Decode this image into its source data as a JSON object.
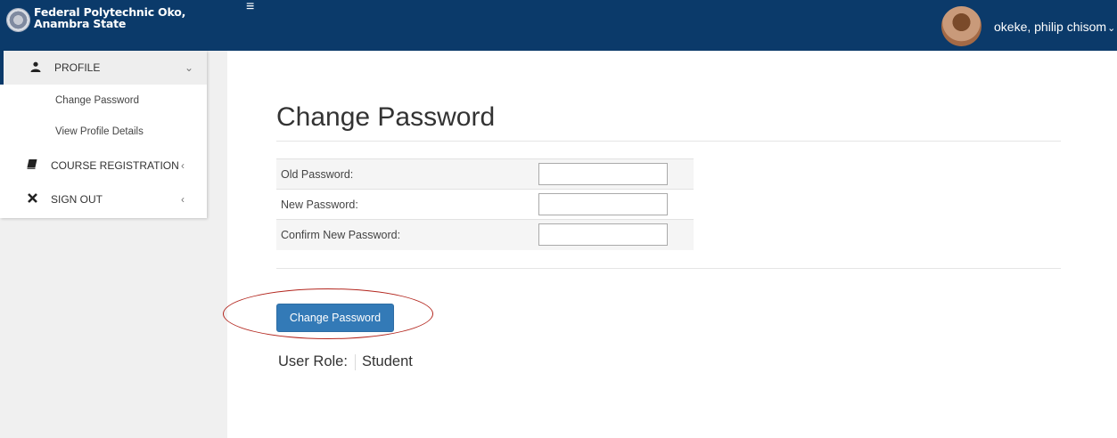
{
  "header": {
    "brand_line1": "Federal Polytechnic Oko,",
    "brand_line2": "Anambra State",
    "menu_icon": "hamburger-icon",
    "user_name": "okeke, philip chisom",
    "user_caret": "⌄"
  },
  "sidebar": {
    "items": [
      {
        "label": "PROFILE",
        "icon": "user-icon",
        "caret": "⌄"
      },
      {
        "label": "COURSE REGISTRATION",
        "icon": "book-icon",
        "caret": "‹"
      },
      {
        "label": "SIGN OUT",
        "icon": "close-icon",
        "caret": "‹"
      }
    ],
    "profile_sub": [
      "Change Password",
      "View Profile Details"
    ]
  },
  "main": {
    "title": "Change Password",
    "fields": [
      {
        "label": "Old Password:",
        "value": ""
      },
      {
        "label": "New Password:",
        "value": ""
      },
      {
        "label": "Confirm New Password:",
        "value": ""
      }
    ],
    "submit_label": "Change Password",
    "role_label": "User Role:",
    "role_value": "Student"
  },
  "colors": {
    "header_bg": "#0b3a6a",
    "button_bg": "#337ab7",
    "annotation_ring": "#b3261e"
  }
}
